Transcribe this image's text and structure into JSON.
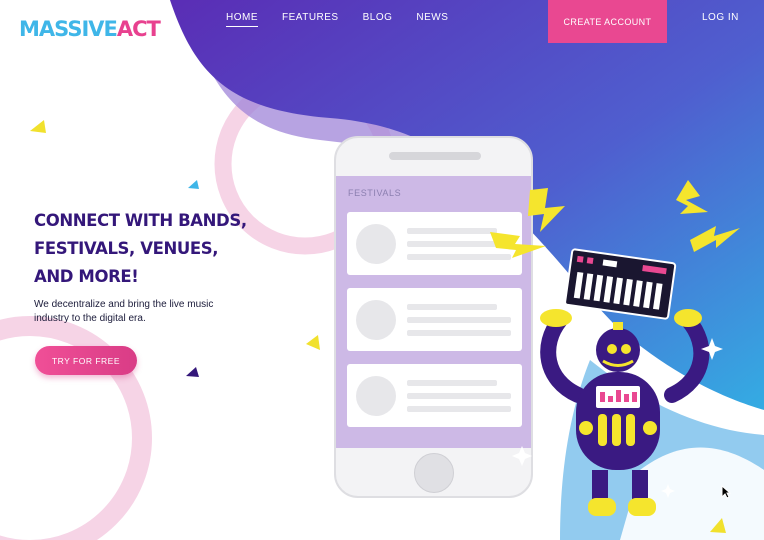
{
  "brand": {
    "part1": "MASSIVE",
    "part2": "ACT",
    "color_part1": "#3fb6e8",
    "color_part2": "#e8418f"
  },
  "nav": {
    "items": [
      {
        "label": "HOME",
        "active": true
      },
      {
        "label": "FEATURES",
        "active": false
      },
      {
        "label": "BLOG",
        "active": false
      },
      {
        "label": "NEWS",
        "active": false
      }
    ]
  },
  "header": {
    "create_account_label": "CREATE ACCOUNT",
    "login_label": "LOG IN"
  },
  "hero": {
    "headline_lines": [
      "CONNECT WITH BANDS,",
      "FESTIVALS, VENUES,",
      "AND MORE!"
    ],
    "subtext": "We decentralize and bring the live music industry to the digital era.",
    "cta_label": "TRY FOR FREE"
  },
  "phone": {
    "screen_title": "FESTIVALS",
    "cards": [
      {},
      {},
      {}
    ]
  },
  "icons": [
    "cursor-icon",
    "lightning-bolt-icon",
    "keyboard-icon",
    "robot-illustration",
    "sparkle-icon",
    "triangle-icon"
  ],
  "colors": {
    "accent_pink": "#e94891",
    "headline_purple": "#34177a",
    "hero_gradient_start": "#5b2fb8",
    "hero_gradient_end": "#3aa8e2",
    "phone_screen": "#cdb9e6"
  }
}
